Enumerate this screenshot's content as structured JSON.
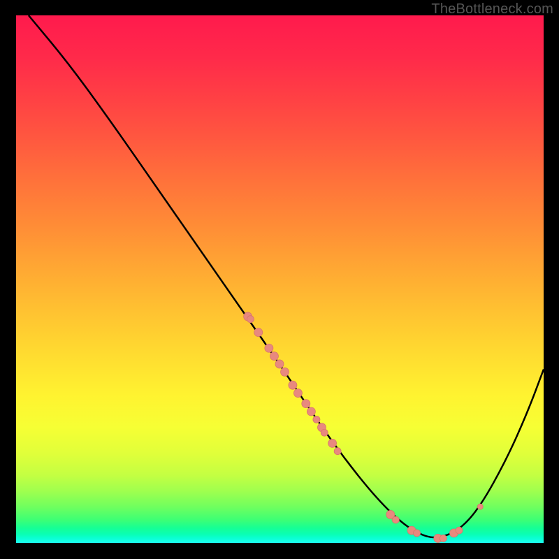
{
  "watermark": "TheBottleneck.com",
  "chart_data": {
    "type": "line",
    "title": "",
    "xlabel": "",
    "ylabel": "",
    "xlim": [
      0,
      100
    ],
    "ylim": [
      0,
      100
    ],
    "grid": false,
    "legend": false,
    "curve": [
      {
        "x": 2.5,
        "y": 100
      },
      {
        "x": 10,
        "y": 91
      },
      {
        "x": 18,
        "y": 80
      },
      {
        "x": 26,
        "y": 68.5
      },
      {
        "x": 34,
        "y": 57
      },
      {
        "x": 42,
        "y": 45.5
      },
      {
        "x": 50,
        "y": 34
      },
      {
        "x": 56,
        "y": 25
      },
      {
        "x": 62,
        "y": 16.5
      },
      {
        "x": 68,
        "y": 9
      },
      {
        "x": 73,
        "y": 4
      },
      {
        "x": 77,
        "y": 1.5
      },
      {
        "x": 80,
        "y": 1
      },
      {
        "x": 84,
        "y": 2.5
      },
      {
        "x": 88,
        "y": 7
      },
      {
        "x": 93,
        "y": 16
      },
      {
        "x": 97,
        "y": 25
      },
      {
        "x": 100,
        "y": 33
      }
    ],
    "points": [
      {
        "x": 44,
        "y": 43,
        "r": 6
      },
      {
        "x": 44.5,
        "y": 42.5,
        "r": 5
      },
      {
        "x": 46,
        "y": 40,
        "r": 6
      },
      {
        "x": 48,
        "y": 37,
        "r": 6
      },
      {
        "x": 49,
        "y": 35.5,
        "r": 6
      },
      {
        "x": 50,
        "y": 34,
        "r": 6
      },
      {
        "x": 51,
        "y": 32.5,
        "r": 6
      },
      {
        "x": 52.5,
        "y": 30,
        "r": 6
      },
      {
        "x": 53.5,
        "y": 28.5,
        "r": 6
      },
      {
        "x": 55,
        "y": 26.5,
        "r": 6
      },
      {
        "x": 56,
        "y": 25,
        "r": 6
      },
      {
        "x": 57,
        "y": 23.5,
        "r": 5
      },
      {
        "x": 58,
        "y": 22,
        "r": 6
      },
      {
        "x": 58.5,
        "y": 21,
        "r": 5
      },
      {
        "x": 60,
        "y": 19,
        "r": 6
      },
      {
        "x": 61,
        "y": 17.5,
        "r": 5
      },
      {
        "x": 71,
        "y": 5.5,
        "r": 6
      },
      {
        "x": 72,
        "y": 4.5,
        "r": 5
      },
      {
        "x": 75,
        "y": 2.5,
        "r": 6
      },
      {
        "x": 76,
        "y": 2,
        "r": 5
      },
      {
        "x": 80,
        "y": 1,
        "r": 6
      },
      {
        "x": 81,
        "y": 1,
        "r": 5
      },
      {
        "x": 83,
        "y": 2,
        "r": 6
      },
      {
        "x": 84,
        "y": 2.5,
        "r": 5
      },
      {
        "x": 88,
        "y": 7,
        "r": 4
      }
    ],
    "colors": {
      "curve": "#000000",
      "point_fill": "#e8897e",
      "point_stroke": "#d8766b"
    }
  }
}
